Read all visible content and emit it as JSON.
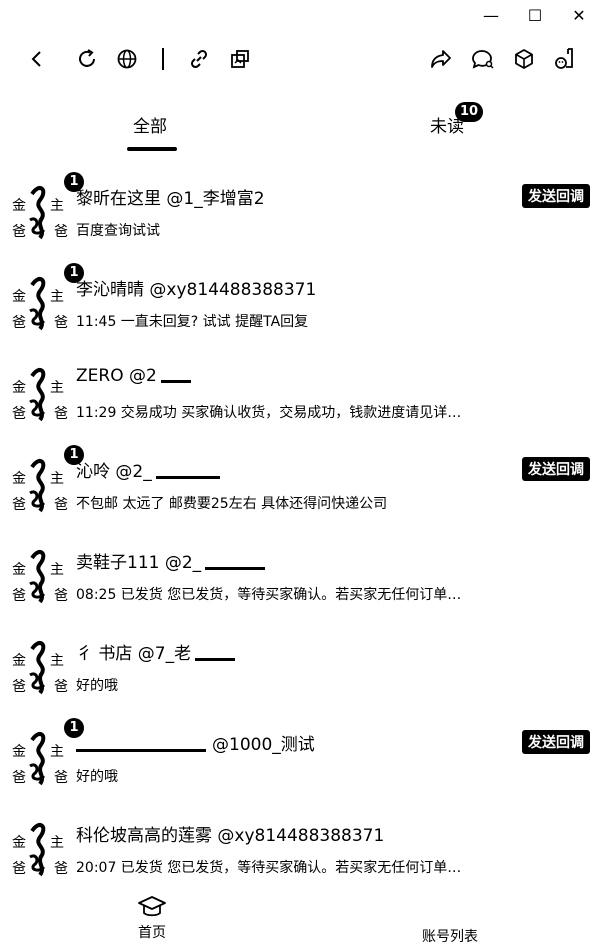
{
  "window": {
    "minimize_glyph": "—",
    "maximize_glyph": "☐",
    "close_glyph": "✕"
  },
  "toolbar": {
    "icons": [
      "back-icon",
      "refresh-icon",
      "globe-icon",
      "link-icon",
      "screenshot-icon",
      "share-icon",
      "chat-search-icon",
      "cube-icon",
      "user-file-icon"
    ]
  },
  "tabs": {
    "all_label": "全部",
    "unread_label": "未读",
    "unread_badge": "10"
  },
  "conversations": [
    {
      "unread": "1",
      "name": "黎昕在这里 @1_李增富2",
      "preview": "百度查询试试",
      "tag": "发送回调"
    },
    {
      "unread": "1",
      "name": "李沁晴晴 @xy814488388371",
      "preview": "11:45 一直未回复? 试试 提醒TA回复",
      "tag": ""
    },
    {
      "unread": "",
      "name": "ZERO @2",
      "preview": "11:29 交易成功 买家确认收货，交易成功，钱款进度请见详…",
      "tag": ""
    },
    {
      "unread": "1",
      "name": "沁呤 @2_",
      "preview": "不包邮 太远了 邮费要25左右 具体还得问快递公司",
      "tag": "发送回调"
    },
    {
      "unread": "",
      "name": "卖鞋子111 @2_",
      "preview": "08:25 已发货 您已发货，等待买家确认。若买家无任何订单…",
      "tag": ""
    },
    {
      "unread": "",
      "name": "彳 书店 @7_老",
      "preview": "好的哦",
      "tag": ""
    },
    {
      "unread": "1",
      "name": "@1000_测试",
      "preview": "好的哦",
      "tag": "发送回调"
    },
    {
      "unread": "",
      "name": "科伦坡高高的莲雾 @xy814488388371",
      "preview": "20:07 已发货 您已发货，等待买家确认。若买家无任何订单…",
      "tag": ""
    }
  ],
  "bottom_nav": {
    "home_label": "首页",
    "accounts_label": "账号列表"
  }
}
